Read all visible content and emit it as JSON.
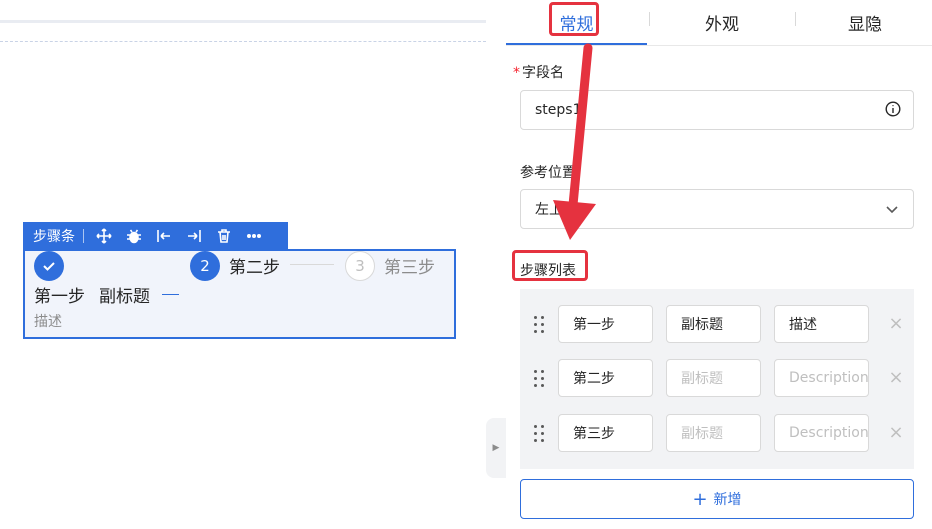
{
  "toolbar": {
    "title": "步骤条",
    "icons": [
      "move-icon",
      "bug-icon",
      "align-left-icon",
      "align-right-icon",
      "delete-icon",
      "more-icon"
    ]
  },
  "steps_preview": {
    "step1": {
      "title": "第一步",
      "subtitle": "副标题",
      "description": "描述"
    },
    "step2": {
      "number": "2",
      "title": "第二步"
    },
    "step3": {
      "number": "3",
      "title": "第三步"
    }
  },
  "panel": {
    "tabs": [
      {
        "label": "常规",
        "active": true
      },
      {
        "label": "外观",
        "active": false
      },
      {
        "label": "显隐",
        "active": false
      }
    ],
    "field_name": {
      "label": "字段名",
      "required_mark": "*",
      "value": "steps1"
    },
    "position": {
      "label": "参考位置",
      "value": "左上"
    },
    "steps_list": {
      "label": "步骤列表",
      "rows": [
        {
          "title": "第一步",
          "subtitle": "副标题",
          "subtitle_placeholder": "副标题",
          "description": "描述",
          "description_placeholder": "Description"
        },
        {
          "title": "第二步",
          "subtitle": "",
          "subtitle_placeholder": "副标题",
          "description": "",
          "description_placeholder": "Description"
        },
        {
          "title": "第三步",
          "subtitle": "",
          "subtitle_placeholder": "副标题",
          "description": "",
          "description_placeholder": "Description"
        }
      ],
      "remove_glyph": "×"
    },
    "add_button": {
      "icon": "+",
      "label": "新增"
    }
  },
  "colors": {
    "accent": "#2f6edc",
    "annotation": "#e5323f",
    "required": "#f5222d"
  }
}
